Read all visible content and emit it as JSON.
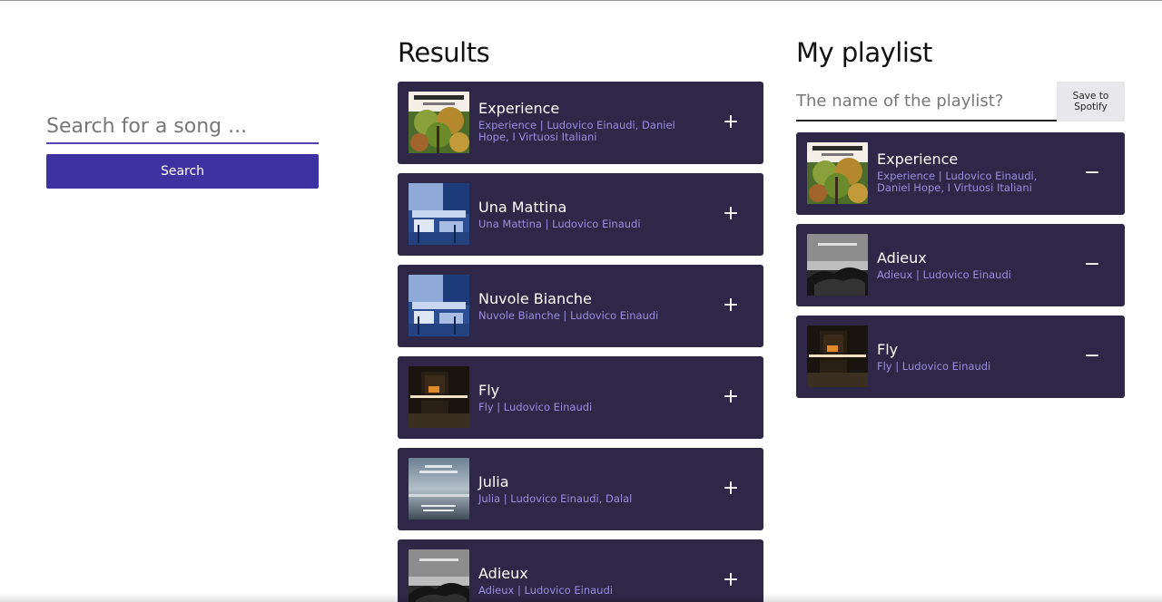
{
  "search": {
    "placeholder": "Search for a song ...",
    "button_label": "Search"
  },
  "results": {
    "title": "Results",
    "tracks": [
      {
        "title": "Experience",
        "subtitle": "Experience | Ludovico Einaudi, Daniel Hope, I Virtuosi Italiani",
        "art": "experience-cover",
        "action": "+"
      },
      {
        "title": "Una Mattina",
        "subtitle": "Una Mattina | Ludovico Einaudi",
        "art": "una-mattina-cover",
        "action": "+"
      },
      {
        "title": "Nuvole Bianche",
        "subtitle": "Nuvole Bianche | Ludovico Einaudi",
        "art": "una-mattina-cover",
        "action": "+"
      },
      {
        "title": "Fly",
        "subtitle": "Fly | Ludovico Einaudi",
        "art": "divenire-cover",
        "action": "+"
      },
      {
        "title": "Julia",
        "subtitle": "Julia | Ludovico Einaudi, Dalal",
        "art": "ruhe-cover",
        "action": "+"
      },
      {
        "title": "Adieux",
        "subtitle": "Adieux | Ludovico Einaudi",
        "art": "adieux-cover",
        "action": "+"
      }
    ]
  },
  "playlist": {
    "title": "My playlist",
    "name_placeholder": "The name of the playlist?",
    "save_label": "Save to\nSpotify",
    "tracks": [
      {
        "title": "Experience",
        "subtitle": "Experience | Ludovico Einaudi, Daniel Hope, I Virtuosi Italiani",
        "art": "experience-cover",
        "action": "−"
      },
      {
        "title": "Adieux",
        "subtitle": "Adieux | Ludovico Einaudi",
        "art": "adieux-cover",
        "action": "−"
      },
      {
        "title": "Fly",
        "subtitle": "Fly | Ludovico Einaudi",
        "art": "divenire-cover",
        "action": "−"
      }
    ]
  },
  "colors": {
    "accent": "#3e32a0",
    "card_bg": "#2e2747",
    "subtitle": "#9a8fe0"
  }
}
